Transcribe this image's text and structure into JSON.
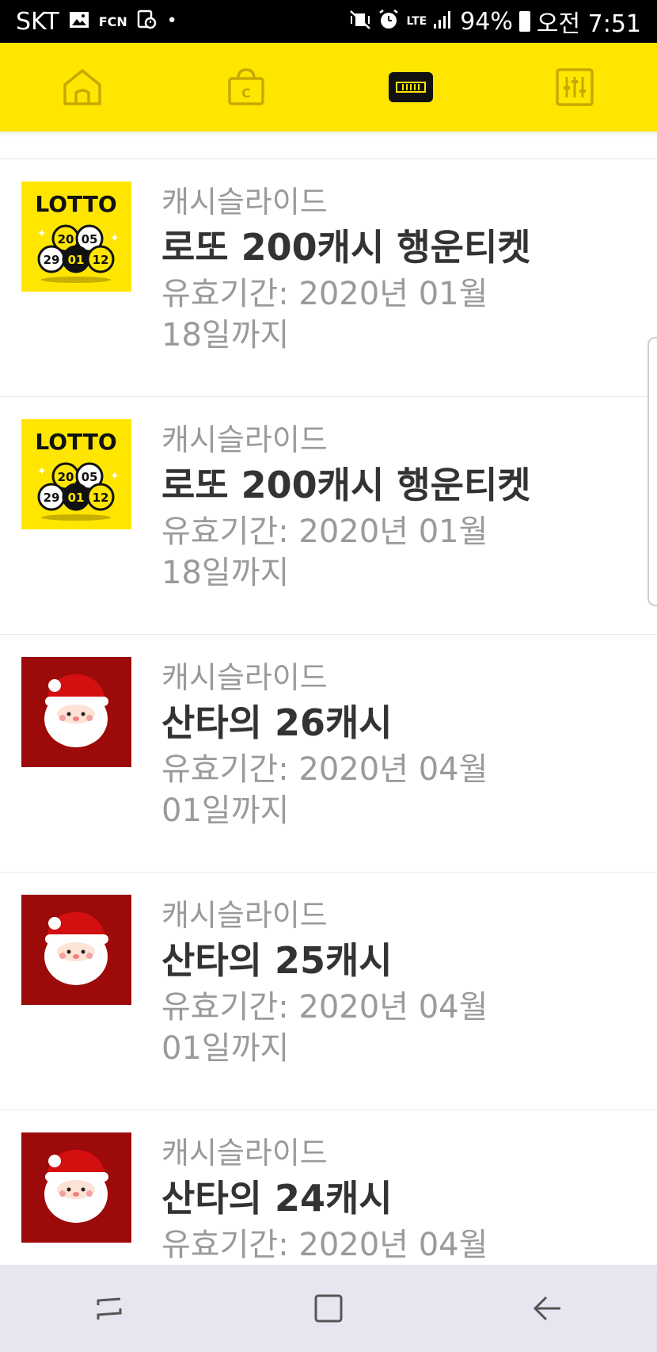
{
  "status_bar": {
    "carrier": "SKT",
    "fcn": "FCN",
    "lte": "LTE",
    "battery": "94%",
    "time": "오전 7:51"
  },
  "tabs": [
    {
      "icon": "home-icon",
      "active": false
    },
    {
      "icon": "shopping-bag-icon",
      "active": false
    },
    {
      "icon": "ticket-icon",
      "active": true
    },
    {
      "icon": "settings-sliders-icon",
      "active": false
    }
  ],
  "items": [
    {
      "provider": "캐시슬라이드",
      "title": "로또 200캐시 행운티켓",
      "validity": "유효기간: 2020년 01월 18일까지",
      "thumb": "lotto",
      "thumb_text": "LOTTO",
      "balls": [
        "20",
        "05",
        "29",
        "01",
        "12"
      ]
    },
    {
      "provider": "캐시슬라이드",
      "title": "로또 200캐시 행운티켓",
      "validity": "유효기간: 2020년 01월 18일까지",
      "thumb": "lotto",
      "thumb_text": "LOTTO",
      "balls": [
        "20",
        "05",
        "29",
        "01",
        "12"
      ]
    },
    {
      "provider": "캐시슬라이드",
      "title": "산타의 26캐시",
      "validity": "유효기간: 2020년 04월 01일까지",
      "thumb": "santa"
    },
    {
      "provider": "캐시슬라이드",
      "title": "산타의 25캐시",
      "validity": "유효기간: 2020년 04월 01일까지",
      "thumb": "santa"
    },
    {
      "provider": "캐시슬라이드",
      "title": "산타의 24캐시",
      "validity": "유효기간: 2020년 04월",
      "thumb": "santa"
    }
  ],
  "colors": {
    "accent_yellow": "#ffe600",
    "santa_red": "#9c0a0a",
    "text_dark": "#333333",
    "text_gray": "#9a9a9a",
    "nav_bg": "#e6e6f0"
  }
}
